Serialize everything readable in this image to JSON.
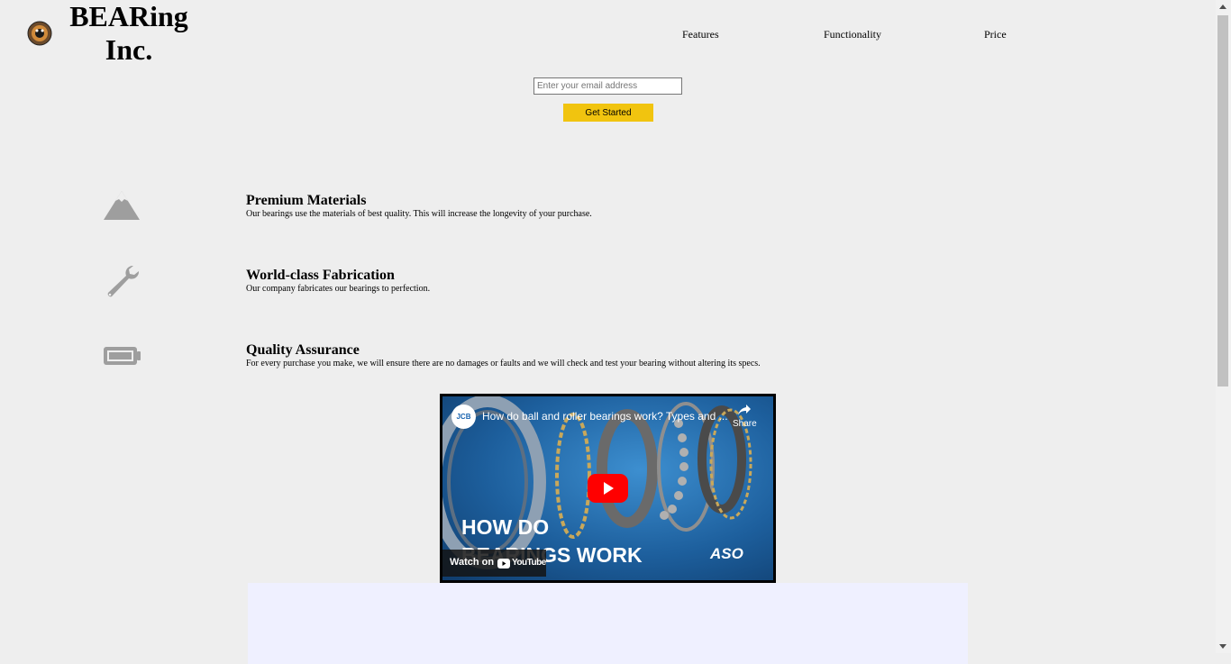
{
  "header": {
    "brand_line1": "BEARing",
    "brand_line2": "Inc.",
    "nav": [
      "Features",
      "Functionality",
      "Price"
    ]
  },
  "form": {
    "email_placeholder": "Enter your email address",
    "submit_label": "Get Started"
  },
  "features": [
    {
      "icon": "mountain-icon",
      "title": "Premium Materials",
      "desc": "Our bearings use the materials of best quality. This will increase the longevity of your purchase."
    },
    {
      "icon": "wrench-icon",
      "title": "World-class Fabrication",
      "desc": "Our company fabricates our bearings to perfection."
    },
    {
      "icon": "battery-icon",
      "title": "Quality Assurance",
      "desc": "For every purchase you make, we will ensure there are no damages or faults and we will check and test your bearing without altering its specs."
    }
  ],
  "video": {
    "title": "How do ball and roller bearings work? Types and ...",
    "share_label": "Share",
    "overlay_line1": "HOW DO",
    "overlay_line2": "BEARINGS WORK",
    "watch_on": "Watch on",
    "youtube": "YouTube",
    "channel_logo": "ASO",
    "channel_badge": "JCB"
  },
  "colors": {
    "background": "#eeeeee",
    "cta": "#f1c40f",
    "icon_gray": "#9e9e9e",
    "pricing_bg": "#eff0ff"
  }
}
